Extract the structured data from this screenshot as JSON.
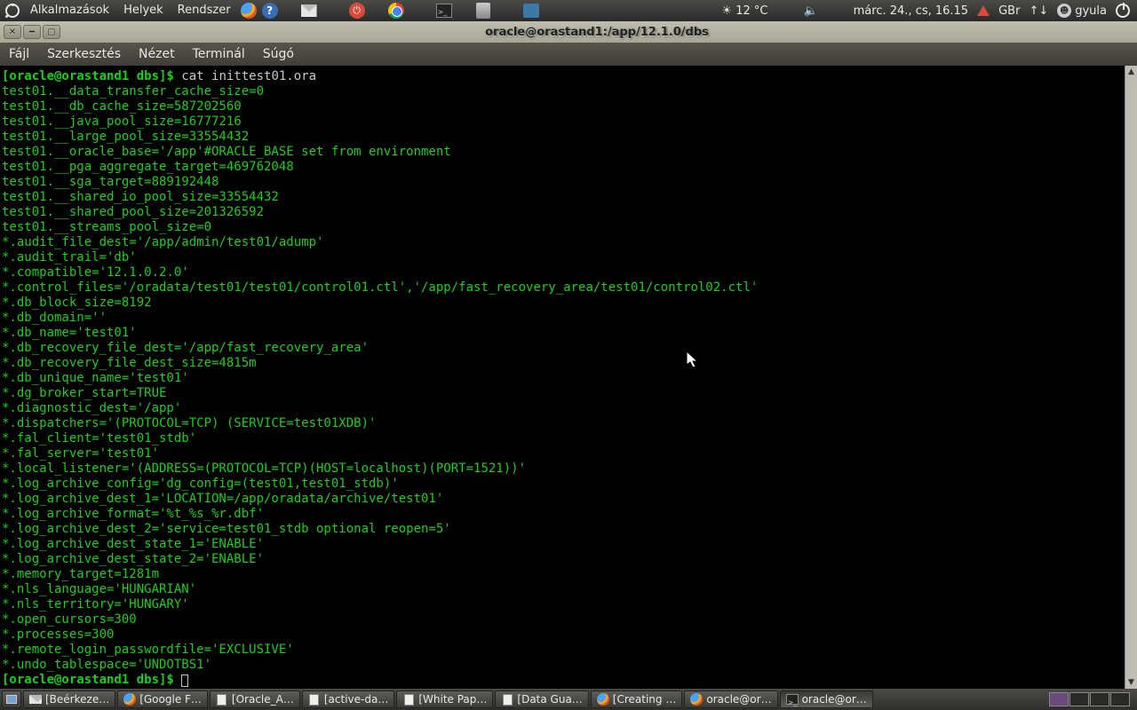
{
  "top_menu": {
    "apps": "Alkalmazások",
    "places": "Helyek",
    "system": "Rendszer"
  },
  "weather": {
    "temp": "12 °C"
  },
  "clock": "márc. 24., cs, 16.15",
  "kb_layout": "GBr",
  "username": "gyula",
  "window": {
    "title": "oracle@orastand1:/app/12.1.0/dbs"
  },
  "app_menu": {
    "file": "Fájl",
    "edit": "Szerkesztés",
    "view": "Nézet",
    "terminal": "Terminál",
    "help": "Súgó"
  },
  "term": {
    "prompt1": "[oracle@orastand1 dbs]$ ",
    "cmd": "cat inittest01.ora",
    "lines": [
      "test01.__data_transfer_cache_size=0",
      "test01.__db_cache_size=587202560",
      "test01.__java_pool_size=16777216",
      "test01.__large_pool_size=33554432",
      "test01.__oracle_base='/app'#ORACLE_BASE set from environment",
      "test01.__pga_aggregate_target=469762048",
      "test01.__sga_target=889192448",
      "test01.__shared_io_pool_size=33554432",
      "test01.__shared_pool_size=201326592",
      "test01.__streams_pool_size=0",
      "*.audit_file_dest='/app/admin/test01/adump'",
      "*.audit_trail='db'",
      "*.compatible='12.1.0.2.0'",
      "*.control_files='/oradata/test01/test01/control01.ctl','/app/fast_recovery_area/test01/control02.ctl'",
      "*.db_block_size=8192",
      "*.db_domain=''",
      "*.db_name='test01'",
      "*.db_recovery_file_dest='/app/fast_recovery_area'",
      "*.db_recovery_file_dest_size=4815m",
      "*.db_unique_name='test01'",
      "*.dg_broker_start=TRUE",
      "*.diagnostic_dest='/app'",
      "*.dispatchers='(PROTOCOL=TCP) (SERVICE=test01XDB)'",
      "*.fal_client='test01_stdb'",
      "*.fal_server='test01'",
      "*.local_listener='(ADDRESS=(PROTOCOL=TCP)(HOST=localhost)(PORT=1521))'",
      "*.log_archive_config='dg_config=(test01,test01_stdb)'",
      "*.log_archive_dest_1='LOCATION=/app/oradata/archive/test01'",
      "*.log_archive_format='%t_%s_%r.dbf'",
      "*.log_archive_dest_2='service=test01_stdb optional reopen=5'",
      "*.log_archive_dest_state_1='ENABLE'",
      "*.log_archive_dest_state_2='ENABLE'",
      "*.memory_target=1281m",
      "*.nls_language='HUNGARIAN'",
      "*.nls_territory='HUNGARY'",
      "*.open_cursors=300",
      "*.processes=300",
      "*.remote_login_passwordfile='EXCLUSIVE'",
      "*.undo_tablespace='UNDOTBS1'"
    ],
    "prompt2": "[oracle@orastand1 dbs]$ "
  },
  "taskbar": [
    {
      "label": "[Beérkeze…",
      "icon": "mail"
    },
    {
      "label": "[Google F…",
      "icon": "firefox"
    },
    {
      "label": "[Oracle_A…",
      "icon": "doc"
    },
    {
      "label": "[active-da…",
      "icon": "doc"
    },
    {
      "label": "[White Pap…",
      "icon": "doc"
    },
    {
      "label": "[Data Gua…",
      "icon": "doc"
    },
    {
      "label": "[Creating …",
      "icon": "firefox"
    },
    {
      "label": "oracle@or…",
      "icon": "firefox"
    },
    {
      "label": "oracle@or…",
      "icon": "term",
      "active": true
    }
  ]
}
